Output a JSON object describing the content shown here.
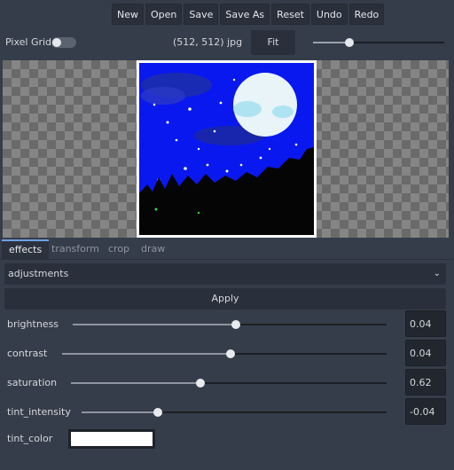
{
  "toolbar": {
    "buttons": [
      "New",
      "Open",
      "Save",
      "Save As",
      "Reset",
      "Undo",
      "Redo"
    ]
  },
  "header": {
    "pixel_grid_label": "Pixel Grid",
    "pixel_grid_on": false,
    "image_info": "(512, 512) jpg",
    "fit_label": "Fit",
    "zoom_fraction": 0.28
  },
  "tabs": [
    {
      "label": "effects",
      "active": true
    },
    {
      "label": "transform",
      "active": false
    },
    {
      "label": "crop",
      "active": false
    },
    {
      "label": "draw",
      "active": false
    }
  ],
  "effect_select": {
    "value": "adjustments"
  },
  "apply_label": "Apply",
  "params": [
    {
      "label": "brightness",
      "fraction": 0.52,
      "value": "0.04"
    },
    {
      "label": "contrast",
      "fraction": 0.52,
      "value": "0.04"
    },
    {
      "label": "saturation",
      "fraction": 0.41,
      "value": "0.62"
    },
    {
      "label": "tint_intensity",
      "fraction": 0.25,
      "value": "-0.04"
    }
  ],
  "tint_color": {
    "label": "tint_color",
    "color": "#ffffff"
  },
  "colors": {
    "background": "#363d4a",
    "button": "#2a303b",
    "accent": "#6ea0e6",
    "sky": "#0a18f0",
    "moon": "#e8f4f8"
  }
}
